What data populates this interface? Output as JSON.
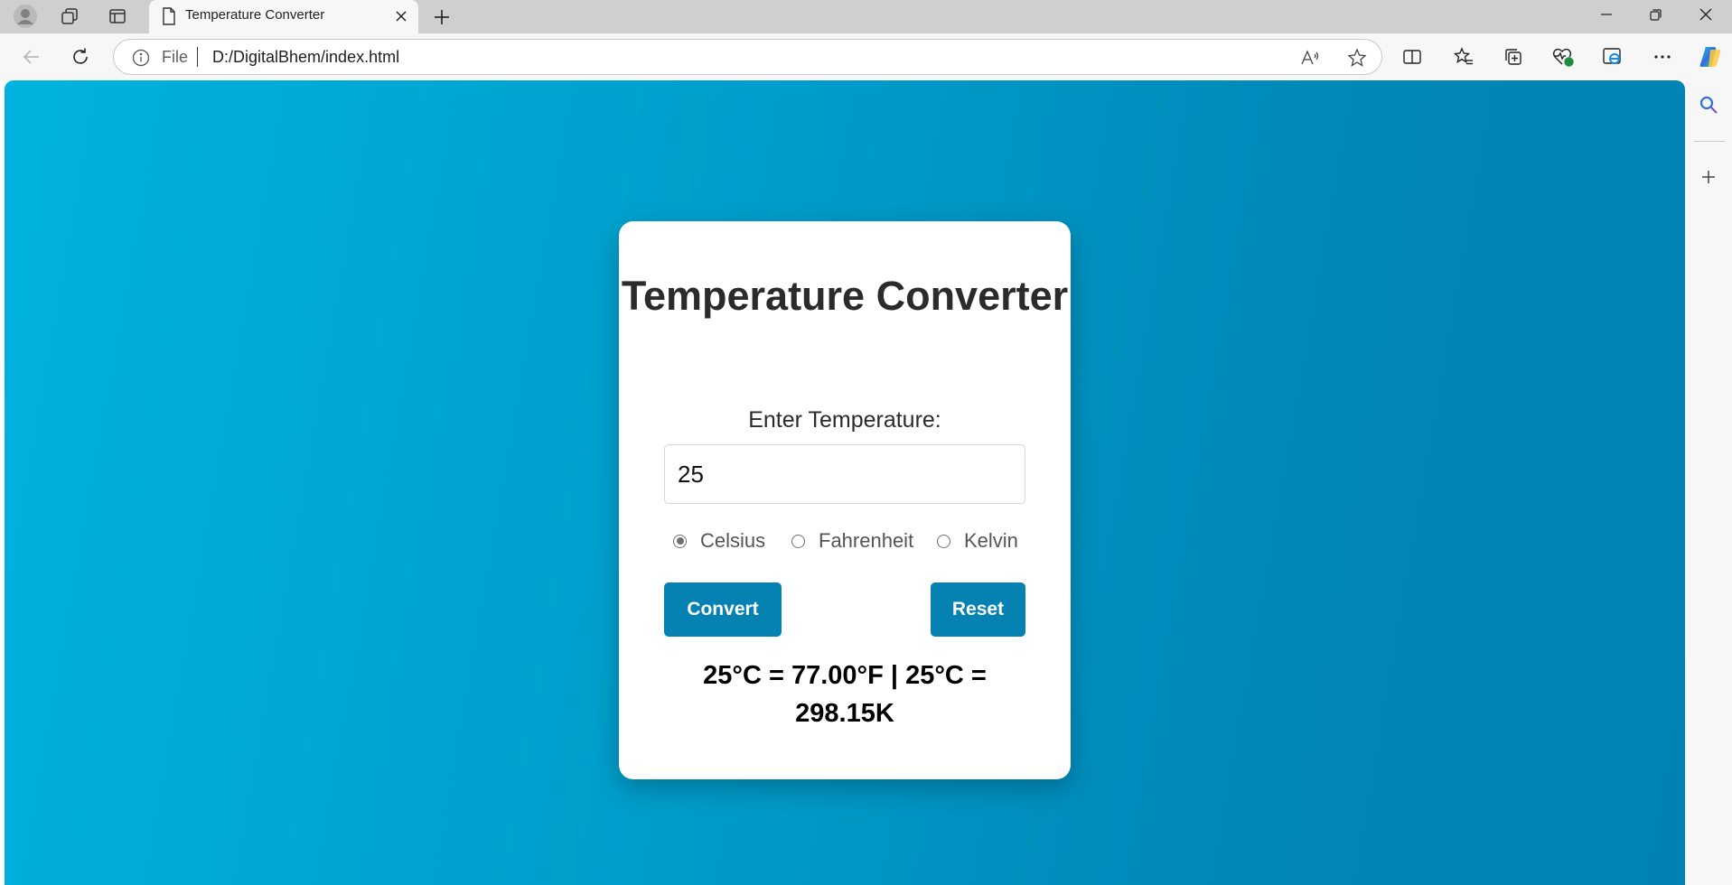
{
  "browser": {
    "tab": {
      "title": "Temperature Converter"
    },
    "address_bar": {
      "scheme_label": "File",
      "url": "D:/DigitalBhem/index.html"
    }
  },
  "page": {
    "title": "Temperature Converter",
    "input_label": "Enter Temperature:",
    "input_value": "25",
    "units": [
      {
        "label": "Celsius",
        "checked": true
      },
      {
        "label": "Fahrenheit",
        "checked": false
      },
      {
        "label": "Kelvin",
        "checked": false
      }
    ],
    "convert_label": "Convert",
    "reset_label": "Reset",
    "result": "25°C = 77.00°F | 25°C = 298.15K"
  },
  "colors": {
    "accent_button": "#0582b2",
    "background_gradient_start": "#00b3df",
    "background_gradient_end": "#0083b3"
  }
}
